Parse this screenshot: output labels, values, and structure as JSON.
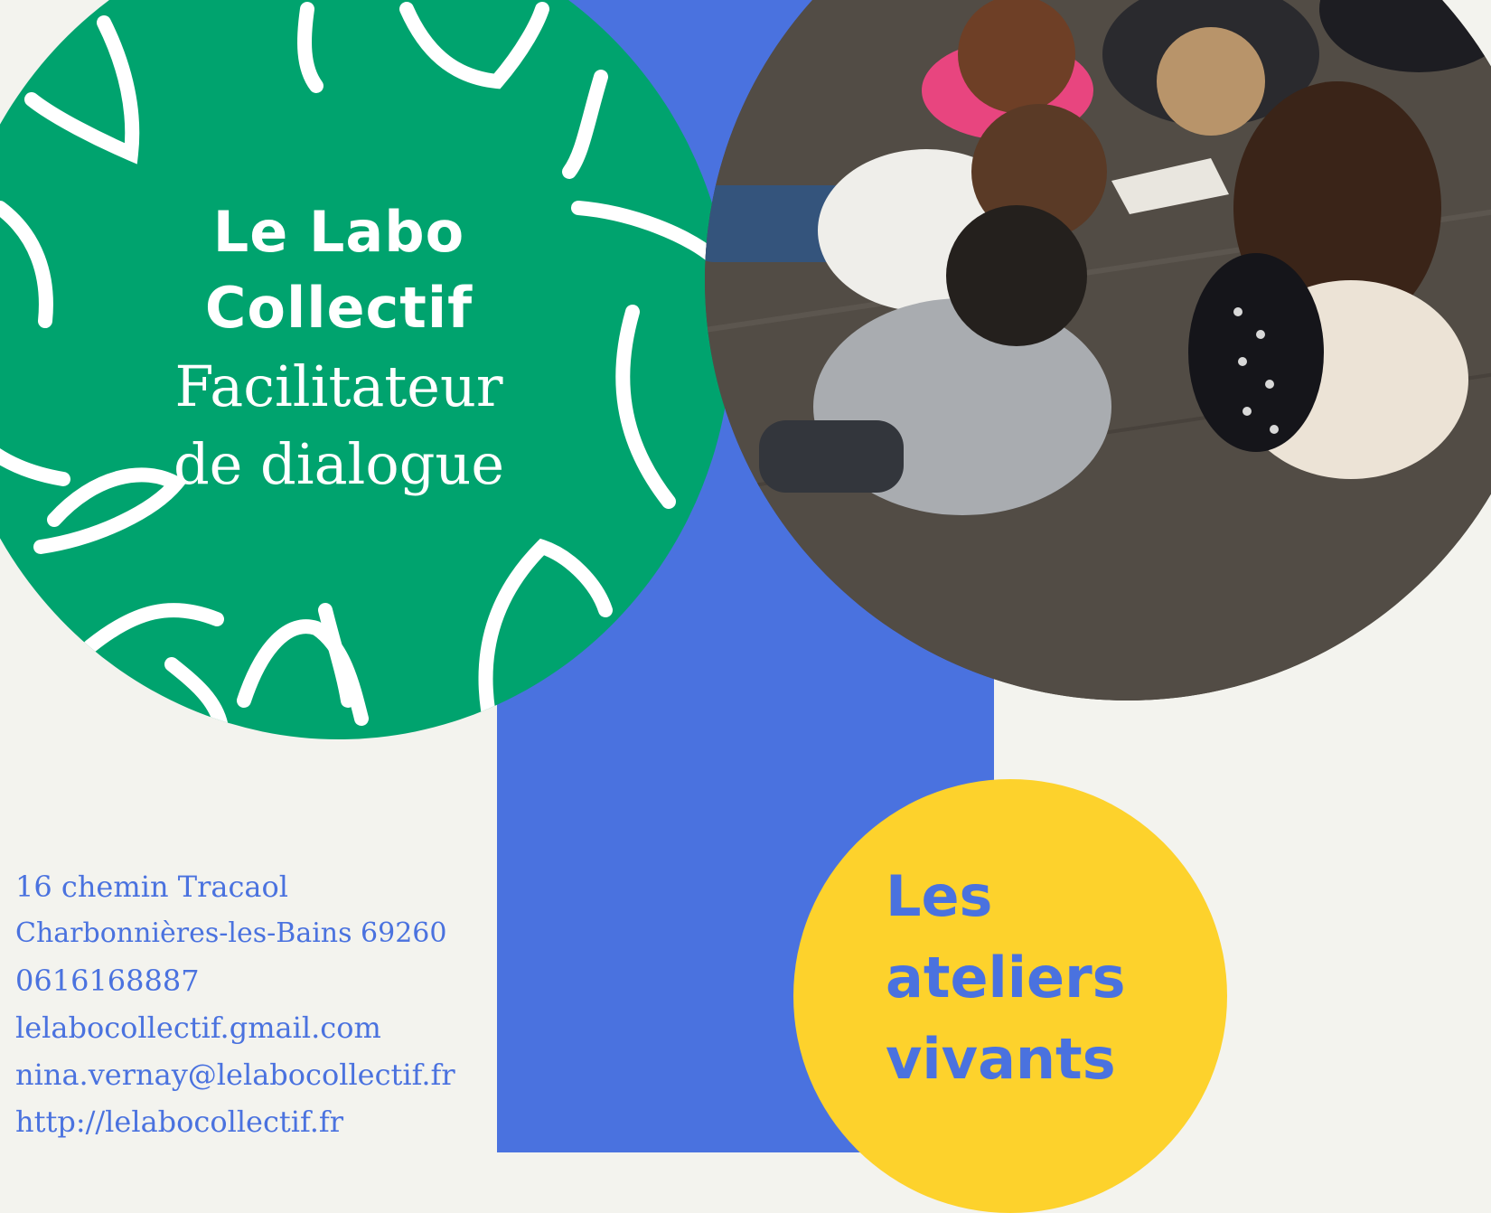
{
  "brand": {
    "name_line1": "Le Labo",
    "name_line2": "Collectif",
    "tagline_line1": "Facilitateur",
    "tagline_line2": "de dialogue"
  },
  "workshop": {
    "line1": "Les",
    "line2": "ateliers",
    "line3": "vivants"
  },
  "contact": {
    "address_line1": "16 chemin Tracaol",
    "address_line2": "Charbonnières-les-Bains 69260",
    "phone": "0616168887",
    "email1": "lelabocollectif.gmail.com",
    "email2": "nina.vernay@lelabocollectif.fr",
    "website": "http://lelabocollectif.fr"
  },
  "colors": {
    "background": "#f3f3ee",
    "green": "#00a36e",
    "blue": "#4a72df",
    "yellow": "#fdd22c"
  }
}
